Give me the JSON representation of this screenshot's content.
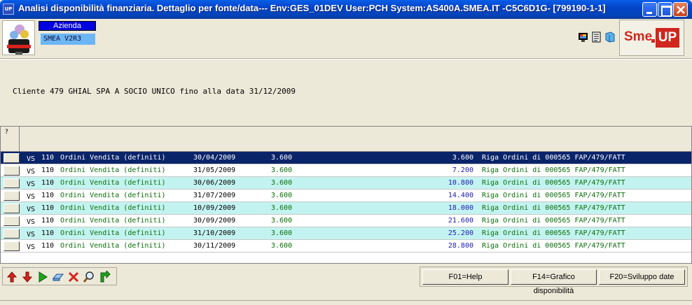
{
  "window": {
    "icon_text": "UP",
    "title": "Analisi disponibilità finanziaria.  Dettaglio per fonte/data--- Env:GES_01DEV User:PCH System:AS400A.SMEA.IT -C5C6D1G- [799190-1-1]"
  },
  "header": {
    "azienda_label": "Azienda",
    "azienda_value": "SMEA  V2R3",
    "brand": {
      "sme": "Sme",
      "up": "UP",
      "color": "#d0261d"
    }
  },
  "cliente_text": "Cliente 479 GHIAL SPA A SOCIO UNICO fino alla data 31/12/2009",
  "grid": {
    "corner_label": "?",
    "rows": [
      {
        "tipo": "VS",
        "codice": "110",
        "descrizione": "Ordini Vendita (definiti)",
        "data": "30/04/2009",
        "importo": "3.600",
        "cumulato": "3.600",
        "riferimento": "Riga Ordini di 000565 FAP/479/FATT"
      },
      {
        "tipo": "VS",
        "codice": "110",
        "descrizione": "Ordini Vendita (definiti)",
        "data": "31/05/2009",
        "importo": "3.600",
        "cumulato": "7.200",
        "riferimento": "Riga Ordini di 000565 FAP/479/FATT"
      },
      {
        "tipo": "VS",
        "codice": "110",
        "descrizione": "Ordini Vendita (definiti)",
        "data": "30/06/2009",
        "importo": "3.600",
        "cumulato": "10.800",
        "riferimento": "Riga Ordini di 000565 FAP/479/FATT"
      },
      {
        "tipo": "VS",
        "codice": "110",
        "descrizione": "Ordini Vendita (definiti)",
        "data": "31/07/2009",
        "importo": "3.600",
        "cumulato": "14.400",
        "riferimento": "Riga Ordini di 000565 FAP/479/FATT"
      },
      {
        "tipo": "VS",
        "codice": "110",
        "descrizione": "Ordini Vendita (definiti)",
        "data": "10/09/2009",
        "importo": "3.600",
        "cumulato": "18.000",
        "riferimento": "Riga Ordini di 000565 FAP/479/FATT"
      },
      {
        "tipo": "VS",
        "codice": "110",
        "descrizione": "Ordini Vendita (definiti)",
        "data": "30/09/2009",
        "importo": "3.600",
        "cumulato": "21.600",
        "riferimento": "Riga Ordini di 000565 FAP/479/FATT"
      },
      {
        "tipo": "VS",
        "codice": "110",
        "descrizione": "Ordini Vendita (definiti)",
        "data": "31/10/2009",
        "importo": "3.600",
        "cumulato": "25.200",
        "riferimento": "Riga Ordini di 000565 FAP/479/FATT"
      },
      {
        "tipo": "VS",
        "codice": "110",
        "descrizione": "Ordini Vendita (definiti)",
        "data": "30/11/2009",
        "importo": "3.600",
        "cumulato": "28.800",
        "riferimento": "Riga Ordini di 000565 FAP/479/FATT"
      }
    ]
  },
  "toolbar": {
    "icons": [
      "arrow-up-icon",
      "arrow-down-icon",
      "play-icon",
      "eraser-icon",
      "delete-icon",
      "search-icon",
      "refresh-icon"
    ],
    "function_keys": [
      {
        "label": "F01=Help"
      },
      {
        "label": "F14=Grafico disponibilità"
      },
      {
        "label": "F20=Sviluppo date"
      }
    ]
  }
}
